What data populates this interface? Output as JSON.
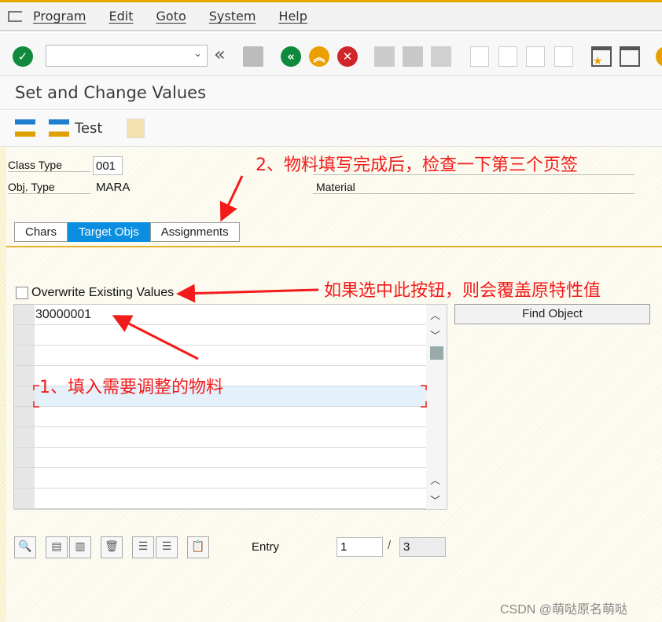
{
  "menu": {
    "items": [
      "Program",
      "Edit",
      "Goto",
      "System",
      "Help"
    ]
  },
  "toolbar": {
    "command_field_value": "",
    "icons": [
      "enter",
      "back",
      "save",
      "back-green",
      "exit",
      "cancel",
      "print",
      "find",
      "find-next",
      "first-page",
      "previous-page",
      "next-page",
      "last-page",
      "create-session",
      "shortcut"
    ]
  },
  "title": "Set and Change Values",
  "app_toolbar": {
    "test_label": "Test"
  },
  "header": {
    "class_type_label": "Class Type",
    "class_type_value": "001",
    "obj_type_label": "Obj. Type",
    "obj_type_value": "MARA",
    "obj_type_desc": "Material"
  },
  "tabs": [
    {
      "label": "Chars",
      "active": false
    },
    {
      "label": "Target Objs",
      "active": true
    },
    {
      "label": "Assignments",
      "active": false
    }
  ],
  "overwrite": {
    "label": "Overwrite Existing Values",
    "checked": false
  },
  "table": {
    "rows": [
      "30000001",
      "",
      "",
      "",
      "",
      "",
      "",
      "",
      "",
      ""
    ],
    "selected_row": 5
  },
  "find_object_label": "Find Object",
  "entry": {
    "label": "Entry",
    "current": "1",
    "separator": "/",
    "total": "3"
  },
  "annotations": {
    "a1": "1、填入需要调整的物料",
    "a2": "2、物料填写完成后，检查一下第三个页签",
    "a3": "如果选中此按钮，则会覆盖原特性值",
    "color": "#f21b1b"
  },
  "watermark": "CSDN @萌哒原名萌哒"
}
